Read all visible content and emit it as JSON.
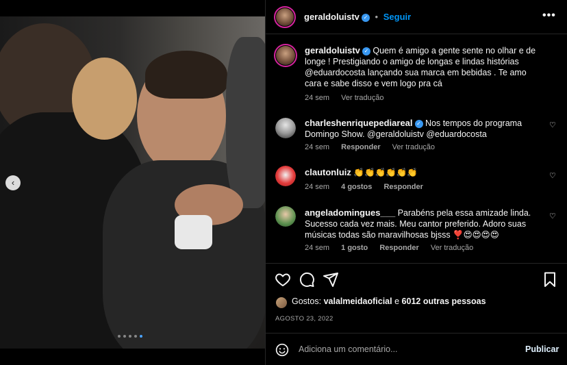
{
  "post": {
    "author": "geraldoluistv",
    "follow_label": "Seguir",
    "separator": "•",
    "more_label": "•••"
  },
  "caption": {
    "author": "geraldoluistv",
    "text": "Quem é amigo a gente sente no olhar e de longe ! Prestigiando o amigo de longas e lindas histórias @eduardocosta lançando sua marca em bebidas . Te amo cara e sabe disso e vem logo pra cá",
    "time": "24 sem",
    "translate": "Ver tradução"
  },
  "comments": [
    {
      "author": "charleshenriquepediareal",
      "verified": true,
      "text": "Nos tempos do programa Domingo Show. @geraldoluistv @eduardocosta",
      "time": "24 sem",
      "reply": "Responder",
      "translate": "Ver tradução",
      "avatar_color": "#d9d9d9"
    },
    {
      "author": "clautonluiz",
      "verified": false,
      "text": "👏👏👏👏👏👏",
      "time": "24 sem",
      "likes": "4 gostos",
      "reply": "Responder",
      "avatar_color": "#e23b3b"
    },
    {
      "author": "angeladomingues___",
      "verified": false,
      "text": "Parabéns pela essa amizade linda. Sucesso cada vez mais. Meu cantor preferido. Adoro suas músicas todas são maravilhosas bjsss ❣️😍😍😍😍",
      "time": "24 sem",
      "likes": "1 gosto",
      "reply": "Responder",
      "translate": "Ver tradução",
      "avatar_color": "#5a8f4e"
    }
  ],
  "likes": {
    "prefix": "Gostos:",
    "user": "valalmeidaoficial",
    "connector": "e",
    "others": "6012 outras pessoas"
  },
  "date": "AGOSTO 23, 2022",
  "add_comment": {
    "placeholder": "Adiciona um comentário...",
    "publish_label": "Publicar"
  },
  "carousel": {
    "prev_label": "‹",
    "slide_count": 5,
    "active_slide": 5
  },
  "colors": {
    "accent": "#0095f6",
    "verified": "#3897f0",
    "background": "#000000",
    "muted": "#a8a8a8"
  },
  "icons": [
    "heart-icon",
    "comment-icon",
    "share-icon",
    "bookmark-icon",
    "emoji-icon",
    "more-icon",
    "chevron-left-icon",
    "verified-icon"
  ]
}
